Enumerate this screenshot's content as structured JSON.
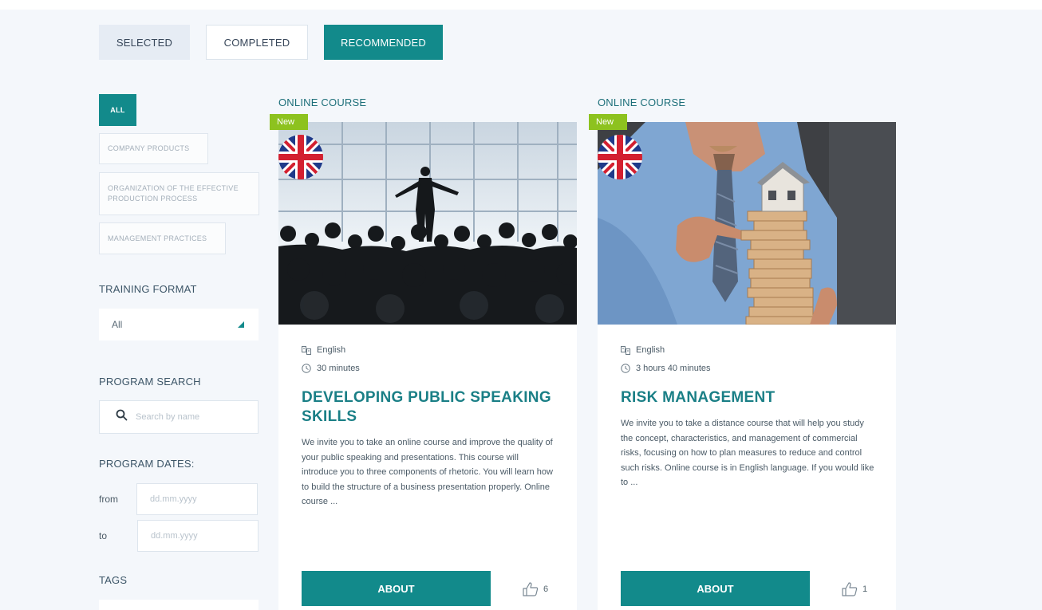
{
  "tabs": [
    {
      "label": "SELECTED"
    },
    {
      "label": "COMPLETED"
    },
    {
      "label": "RECOMMENDED"
    }
  ],
  "sidebar": {
    "categories": [
      {
        "label": "ALL"
      },
      {
        "label": "COMPANY PRODUCTS"
      },
      {
        "label": "ORGANIZATION OF THE EFFECTIVE PRODUCTION PROCESS"
      },
      {
        "label": "MANAGEMENT PRACTICES"
      }
    ],
    "training_format": {
      "label": "TRAINING FORMAT",
      "value": "All"
    },
    "program_search": {
      "label": "PROGRAM SEARCH",
      "placeholder": "Search by name"
    },
    "program_dates": {
      "label": "PROGRAM DATES:",
      "from_label": "from",
      "to_label": "to",
      "placeholder": "dd.mm.yyyy"
    },
    "tags": {
      "label": "TAGS"
    }
  },
  "cards": [
    {
      "type": "ONLINE COURSE",
      "badge": "New",
      "language": "English",
      "duration": "30 minutes",
      "title": "DEVELOPING PUBLIC SPEAKING SKILLS",
      "description": "We invite you to take an online course and improve the quality of your public speaking and presentations. This course will introduce you to three components of rhetoric. You will learn how to build the structure of a business presentation properly. Online course ...",
      "button": "ABOUT",
      "likes": "6"
    },
    {
      "type": "ONLINE COURSE",
      "badge": "New",
      "language": "English",
      "duration": "3 hours 40 minutes",
      "title": "RISK MANAGEMENT",
      "description": "We invite you to take a distance course that will help you study the concept, characteristics, and management of commercial risks, focusing on how to plan measures to reduce and control such risks. Online course is in English language. If you would like to ...",
      "button": "ABOUT",
      "likes": "1"
    }
  ],
  "colors": {
    "accent": "#128a8b",
    "badge": "#8dc21f",
    "title": "#1a7f86"
  }
}
